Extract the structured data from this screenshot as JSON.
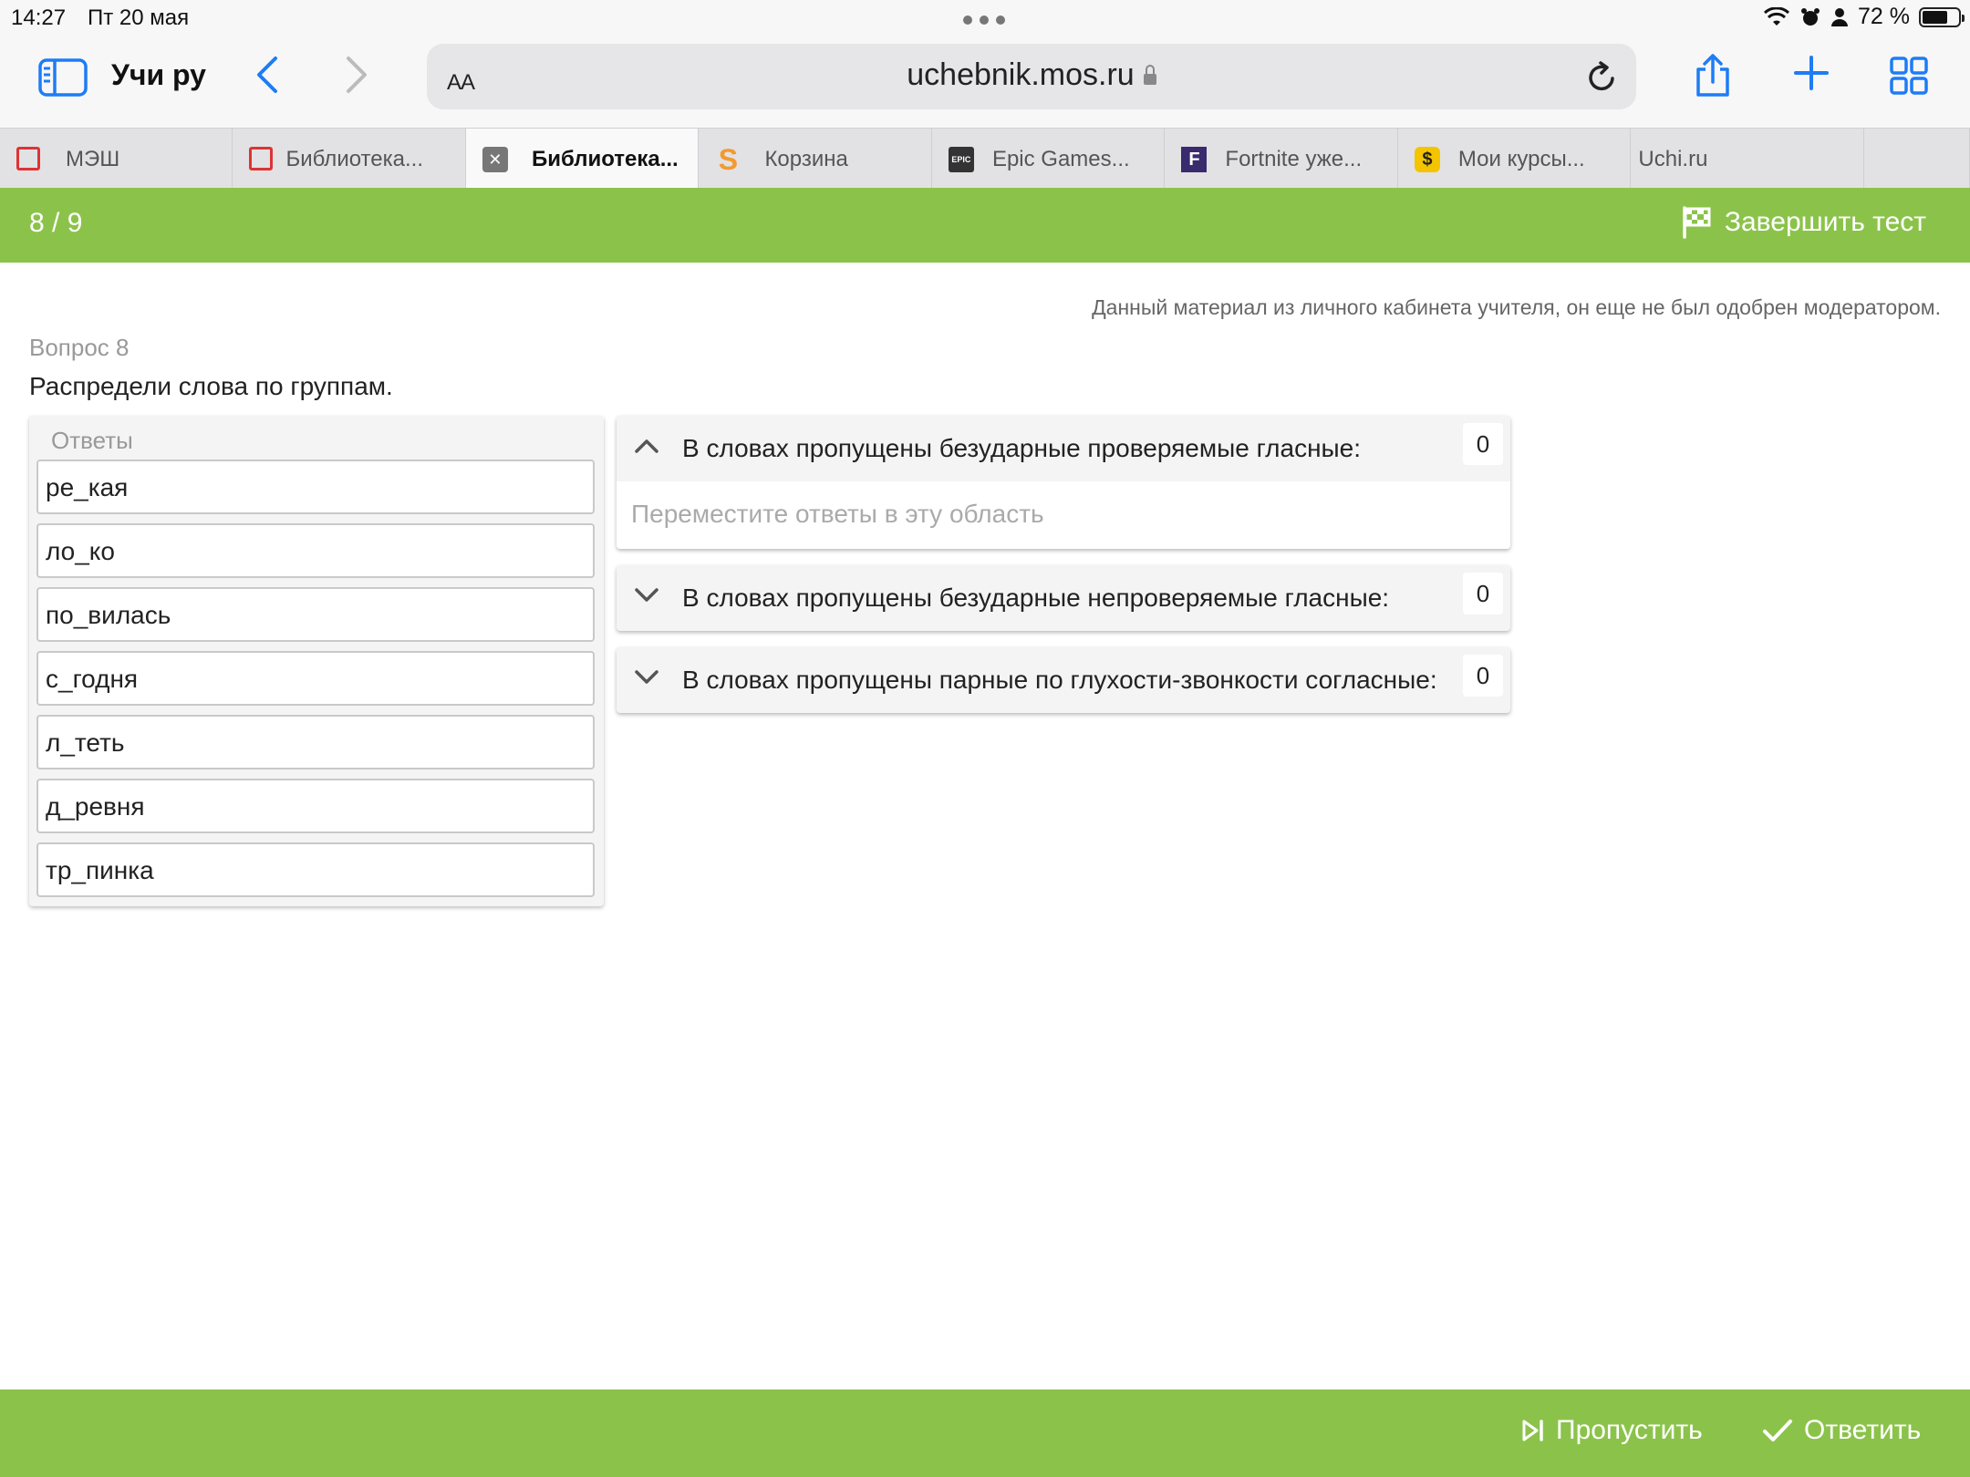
{
  "status_bar": {
    "time": "14:27",
    "date": "Пт 20 мая",
    "battery": "72 %",
    "battery_level": 0.72
  },
  "browser": {
    "site_title": "Учи ру",
    "address_aa": "AA",
    "url": "uchebnik.mos.ru",
    "tabs": [
      {
        "label": "МЭШ",
        "icon": "mesh-icon",
        "active": false
      },
      {
        "label": "Библиотека...",
        "icon": "mesh-icon",
        "active": false
      },
      {
        "label": "Библиотека...",
        "icon": "close-icon",
        "active": true
      },
      {
        "label": "Корзина",
        "icon": "s-icon",
        "active": false
      },
      {
        "label": "Epic Games...",
        "icon": "epic-icon",
        "active": false
      },
      {
        "label": "Fortnite уже...",
        "icon": "fortnite-icon",
        "active": false
      },
      {
        "label": "Мои курсы...",
        "icon": "dollar-icon",
        "active": false
      },
      {
        "label": "Uchi.ru",
        "icon": "",
        "active": false
      }
    ]
  },
  "test": {
    "counter": "8 / 9",
    "finish_label": "Завершить тест",
    "notice": "Данный материал из личного кабинета учителя, он еще не был одобрен модератором.",
    "question_number": "Вопрос 8",
    "question_text": "Распредели слова по группам.",
    "answers_title": "Ответы",
    "answers": [
      "ре_кая",
      "ло_ко",
      "по_вилась",
      "с_годня",
      "л_теть",
      "д_ревня",
      "тр_пинка"
    ],
    "groups": [
      {
        "title": "В словах пропущены безударные проверяемые гласные:",
        "count": "0",
        "expanded": true,
        "placeholder": "Переместите ответы в эту область"
      },
      {
        "title": "В словах пропущены безударные непроверяемые гласные:",
        "count": "0",
        "expanded": false
      },
      {
        "title": "В словах пропущены парные по глухости-звонкости согласные:",
        "count": "0",
        "expanded": false
      }
    ],
    "skip_label": "Пропустить",
    "answer_label": "Ответить"
  },
  "colors": {
    "accent_green": "#8bc34a",
    "safari_blue": "#1e7cf5"
  }
}
